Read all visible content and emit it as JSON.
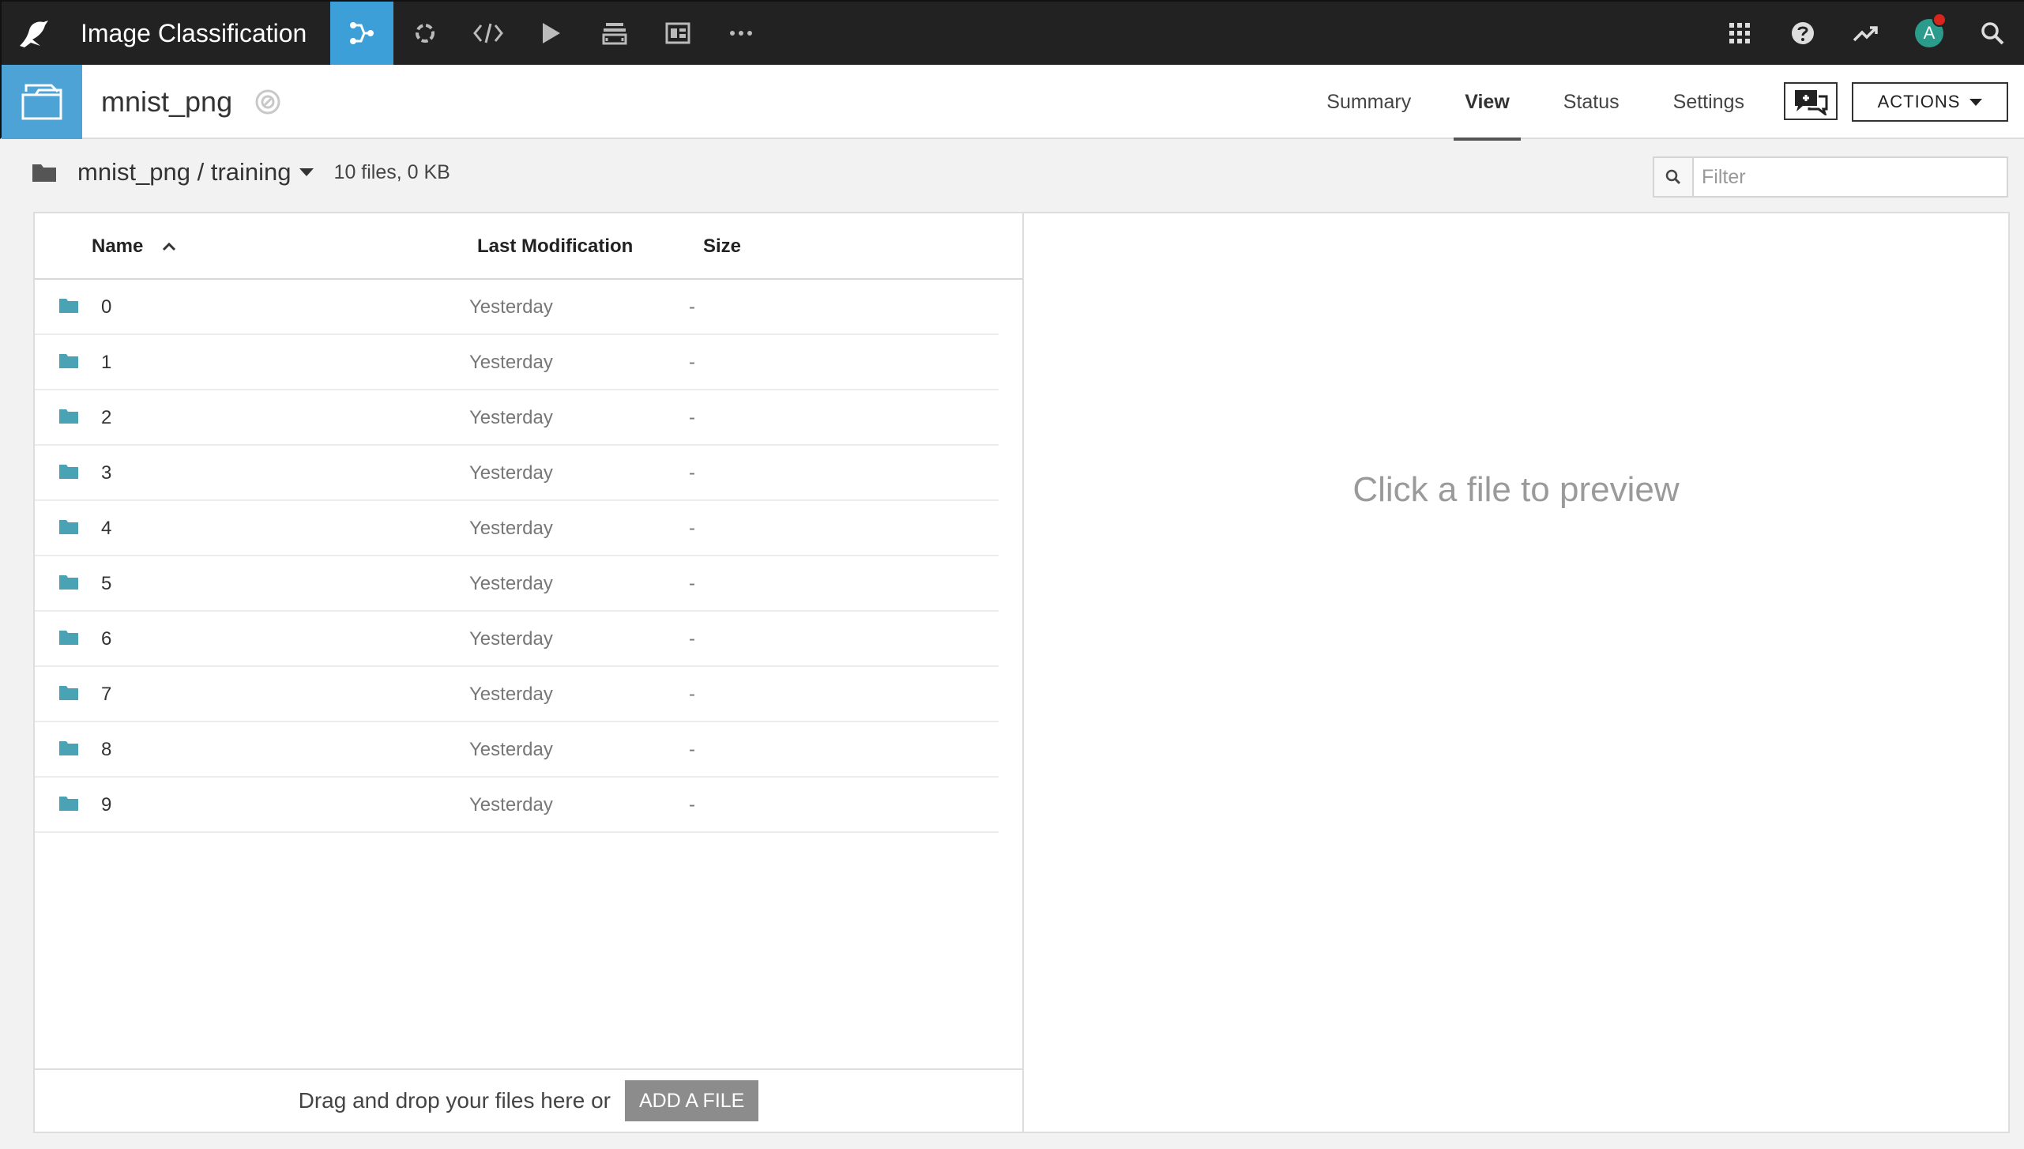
{
  "topbar": {
    "app_title": "Image Classification",
    "nav_icons": [
      "flow-icon",
      "recipe-icon",
      "code-icon",
      "run-icon",
      "stack-icon",
      "dashboard-icon",
      "more-icon"
    ],
    "avatar_initial": "A"
  },
  "object": {
    "name": "mnist_png",
    "tabs": [
      {
        "label": "Summary",
        "active": false
      },
      {
        "label": "View",
        "active": true
      },
      {
        "label": "Status",
        "active": false
      },
      {
        "label": "Settings",
        "active": false
      }
    ],
    "actions_label": "ACTIONS"
  },
  "path": {
    "text": "mnist_png / training",
    "count": "10 files, 0 KB"
  },
  "filter": {
    "placeholder": "Filter"
  },
  "table": {
    "headers": {
      "name": "Name",
      "modified": "Last Modification",
      "size": "Size"
    },
    "rows": [
      {
        "name": "0",
        "modified": "Yesterday",
        "size": "-"
      },
      {
        "name": "1",
        "modified": "Yesterday",
        "size": "-"
      },
      {
        "name": "2",
        "modified": "Yesterday",
        "size": "-"
      },
      {
        "name": "3",
        "modified": "Yesterday",
        "size": "-"
      },
      {
        "name": "4",
        "modified": "Yesterday",
        "size": "-"
      },
      {
        "name": "5",
        "modified": "Yesterday",
        "size": "-"
      },
      {
        "name": "6",
        "modified": "Yesterday",
        "size": "-"
      },
      {
        "name": "7",
        "modified": "Yesterday",
        "size": "-"
      },
      {
        "name": "8",
        "modified": "Yesterday",
        "size": "-"
      },
      {
        "name": "9",
        "modified": "Yesterday",
        "size": "-"
      }
    ]
  },
  "dropzone": {
    "text": "Drag and drop your files here or",
    "button": "ADD A FILE"
  },
  "preview": {
    "message": "Click a file to preview"
  },
  "colors": {
    "topbar_bg": "#222222",
    "accent_blue": "#3c9fd8",
    "folder_teal": "#4aa3b5",
    "notification_red": "#d9261c"
  }
}
